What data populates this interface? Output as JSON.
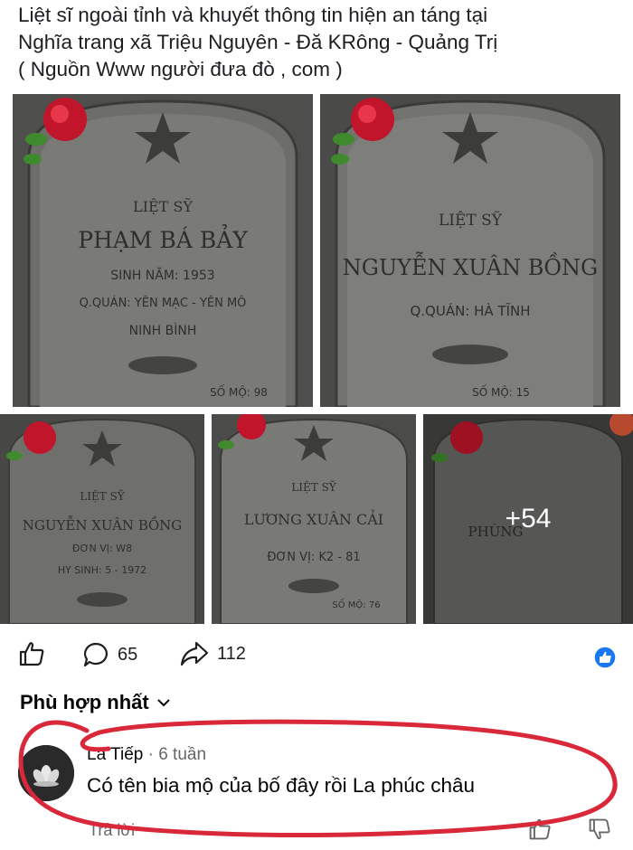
{
  "post": {
    "line1": "Liệt sĩ ngoài tỉnh và khuyết thông tin hiện an táng tại",
    "line2": "Nghĩa trang xã Triệu Nguyên - Đă KRông - Quảng Trị",
    "line3": "( Nguồn Www người đưa đò , com )"
  },
  "gallery": {
    "photos": [
      {
        "title": "LIỆT SỸ",
        "name": "PHẠM BÁ BẢY",
        "line1": "SINH NĂM: 1953",
        "line2": "Q.QUÁN: YÊN MẠC - YÊN MÔ",
        "line3": "NINH BÌNH",
        "plot": "SỐ MỘ: 98"
      },
      {
        "title": "LIỆT SỸ",
        "name": "NGUYỄN XUÂN BỒNG",
        "line1": "Q.QUÁN: HÀ TĨNH",
        "line2": "",
        "line3": "",
        "plot": "SỐ MỘ: 15"
      },
      {
        "title": "LIỆT SỸ",
        "name": "NGUYỄN XUÂN BỒNG",
        "line1": "ĐƠN VỊ: W8",
        "line2": "HY SINH: 5 - 1972",
        "line3": "",
        "plot": ""
      },
      {
        "title": "LIỆT SỸ",
        "name": "LƯƠNG XUÂN CẢI",
        "line1": "ĐƠN VỊ: K2 - 81",
        "line2": "",
        "line3": "",
        "plot": "SỐ MỘ: 76"
      },
      {
        "title": "",
        "name": "PHÙNG",
        "line1": "",
        "line2": "",
        "line3": "",
        "plot": ""
      }
    ],
    "more_count": "+54"
  },
  "actions": {
    "comments": "65",
    "shares": "112"
  },
  "sort_label": "Phù hợp nhất",
  "comment": {
    "author": "La Tiếp",
    "time": "· 6 tuần",
    "text": "Có tên bia mộ của bố đây rồi La phúc châu",
    "reply": "Trả lời"
  },
  "colors": {
    "like_badge": "#1877f2",
    "annotation": "#d8283a",
    "stone": "#5a5b58"
  }
}
